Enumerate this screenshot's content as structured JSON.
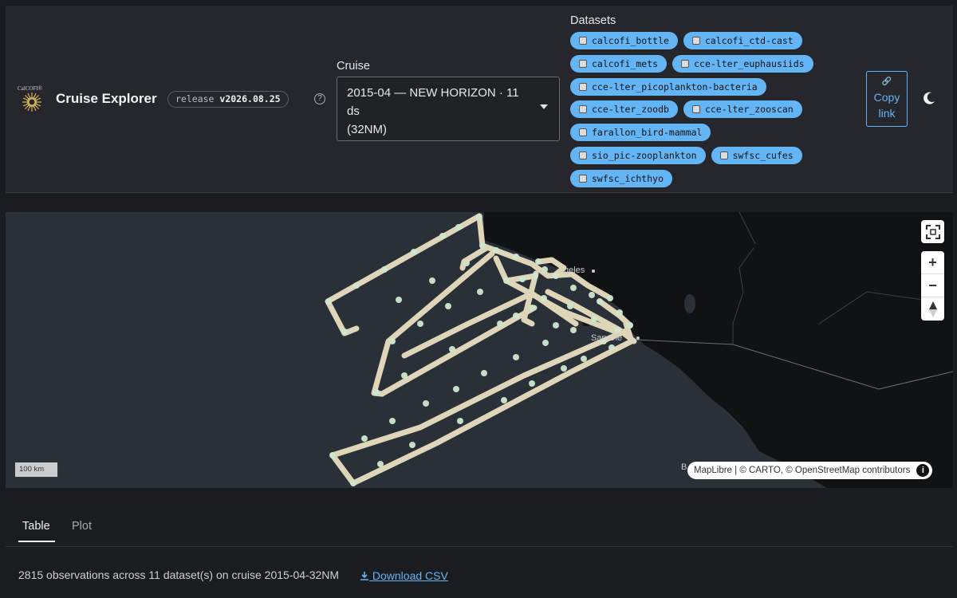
{
  "header": {
    "logo_text": "CalCOFI",
    "logo_mark": "®",
    "app_title": "Cruise Explorer",
    "release_prefix": "release",
    "release_version": "v2026.08.25",
    "help_symbol": "?"
  },
  "cruise": {
    "label": "Cruise",
    "selected_line1": "2015-04 — NEW HORIZON · 11 ds",
    "selected_line2": "(32NM)"
  },
  "datasets": {
    "label": "Datasets",
    "items": [
      "calcofi_bottle",
      "calcofi_ctd-cast",
      "calcofi_mets",
      "cce-lter_euphausiids",
      "cce-lter_picoplankton-bacteria",
      "cce-lter_zoodb",
      "cce-lter_zooscan",
      "farallon_bird-mammal",
      "sio_pic-zooplankton",
      "swfsc_cufes",
      "swfsc_ichthyo"
    ]
  },
  "copy_link": {
    "line1": "Copy",
    "line2": "link",
    "icon": "link-icon"
  },
  "theme_toggle": {
    "icon": "moon-icon"
  },
  "map": {
    "scale_label": "100 km",
    "attribution": "MapLibre | © CARTO, © OpenStreetMap contributors",
    "info_symbol": "i",
    "labels": {
      "la": "geles",
      "sd": "San Die",
      "bc": "B"
    },
    "controls": {
      "fullscreen": "fullscreen-icon",
      "zoom_in": "+",
      "zoom_out": "−",
      "compass": "compass-icon"
    }
  },
  "tabs": {
    "table": "Table",
    "plot": "Plot"
  },
  "summary": {
    "text": "2815 observations across 11 dataset(s) on cruise 2015-04-32NM",
    "download_label": "Download CSV",
    "download_icon": "download-icon"
  },
  "colors": {
    "accent": "#64b5f6",
    "track": "#f0e6c8",
    "station": "#cfe7cf"
  }
}
